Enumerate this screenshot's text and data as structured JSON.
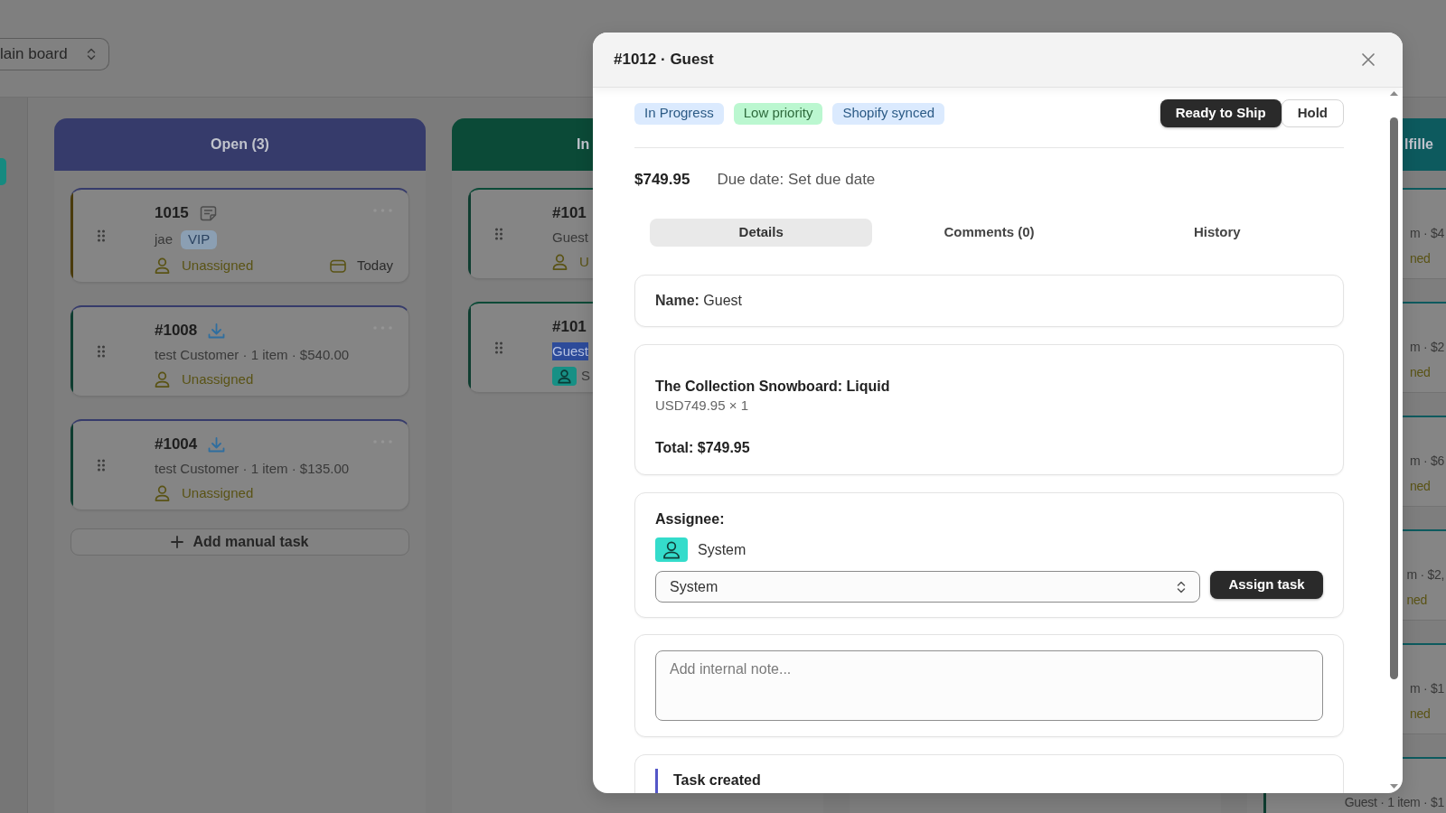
{
  "board": {
    "board_select": {
      "value": "lain board"
    },
    "columns": [
      {
        "kind": "whole",
        "title": "Open (3)",
        "color": "#363b6b",
        "cards": [
          {
            "kind": "manual",
            "title": "1015",
            "customer": "jae",
            "tag": "VIP",
            "assignee": "Unassigned",
            "assigned": false,
            "due": "Today",
            "highlighted": false,
            "color": "#4a3b0c"
          },
          {
            "kind": "order",
            "title": "#1008",
            "customer": "test Customer · 1 item · $540.00",
            "assignee": "Unassigned",
            "assigned": false,
            "highlighted": false,
            "color": "#0e3d30"
          },
          {
            "kind": "order",
            "title": "#1004",
            "customer": "test Customer · 1 item · $135.00",
            "assignee": "Unassigned",
            "assigned": false,
            "highlighted": false,
            "color": "#0e3d30"
          }
        ],
        "add_button": "Add manual task"
      },
      {
        "kind": "leading",
        "title": "In",
        "color": "#0b4a37",
        "cards": [
          {
            "title": "#101",
            "customer": "Guest",
            "assignee": "U",
            "assigned": false,
            "highlighted": false,
            "color": "#0e3d30"
          },
          {
            "title": "#101",
            "customer": "Guest",
            "assignee": "S",
            "assigned": true,
            "highlighted": true,
            "color": "#0e3d30"
          }
        ]
      },
      {},
      {
        "kind": "trailing",
        "title": "lfille",
        "color": "#0d5a5e",
        "cards": [
          {
            "customer": "m · $4",
            "assignee": "ned",
            "assigned": false,
            "highlighted": false
          },
          {
            "customer": "m · $2",
            "assignee": "ned",
            "assigned": false,
            "highlighted": false
          },
          {
            "customer": "m · $6",
            "assignee": "ned",
            "assigned": false,
            "highlighted": false
          },
          {
            "customer": "m · $2,",
            "assignee": "ned",
            "assigned": false,
            "highlighted": false
          },
          {
            "customer": "m · $1",
            "assignee": "ned",
            "assigned": false,
            "highlighted": false
          },
          {
            "customer": "Guest · 1 item · $1",
            "highlighted": false,
            "color": "#0e3d30"
          }
        ]
      }
    ]
  },
  "modal": {
    "title": "#1012 · Guest",
    "tags": [
      {
        "label": "In Progress",
        "kind": "status",
        "color": "#dbeafe"
      },
      {
        "label": "Low priority",
        "kind": "priority",
        "color": "#bbf7d0"
      },
      {
        "label": "Shopify synced",
        "kind": "sync",
        "color": "#dbeafe"
      }
    ],
    "status_buttons": [
      {
        "label": "Ready to Ship",
        "selected": true
      },
      {
        "label": "Hold",
        "selected": false
      }
    ],
    "amount": "$749.95",
    "due_date": "Due date: Set due date",
    "tabs": [
      {
        "label": "Details",
        "selected": true
      },
      {
        "label": "Comments (0)",
        "selected": false
      },
      {
        "label": "History",
        "selected": false
      }
    ],
    "customer_name": "**Name:** Guest",
    "line_items": [
      {
        "title": "The Collection Snowboard: Liquid",
        "price": "USD749.95 × 1"
      }
    ],
    "total": "Total: $749.95",
    "assignee": {
      "heading": "Assignee:",
      "current": "System",
      "select_value": "System",
      "button": "Assign task"
    },
    "note": {
      "placeholder": "Add internal note..."
    },
    "history": [
      {
        "title": "Task created"
      }
    ]
  }
}
